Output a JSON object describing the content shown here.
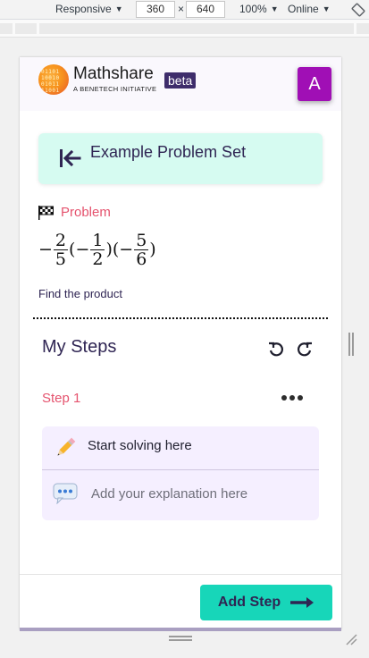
{
  "devtools": {
    "device": "Responsive",
    "width": "360",
    "times": "×",
    "height": "640",
    "zoom": "100%",
    "network": "Online"
  },
  "header": {
    "brand": "Mathshare",
    "tagline": "A BENETECH INITIATIVE",
    "badge": "beta",
    "avatar_letter": "A",
    "avatar_color": "#a00fb5"
  },
  "problem_set": {
    "title": "Example Problem Set"
  },
  "problem": {
    "label": "Problem",
    "expression": {
      "minus": "−",
      "f1_num": "2",
      "f1_den": "5",
      "open": "(",
      "f2_num": "1",
      "f2_den": "2",
      "close_open": ")(",
      "f3_num": "5",
      "f3_den": "6",
      "close": ")"
    },
    "instruction": "Find the product"
  },
  "steps": {
    "title": "My Steps",
    "step_label": "Step 1",
    "solve_placeholder": "Start solving here",
    "explain_placeholder": "Add your explanation here"
  },
  "actions": {
    "add_step": "Add Step"
  },
  "colors": {
    "accent": "#17d6b9",
    "problem_set_bg": "#d6fbf1",
    "highlight": "#e5536e",
    "text_primary": "#2f2553"
  },
  "icons": [
    "chevron-down-icon",
    "rotate-icon",
    "ruler-bar-icon",
    "logo-icon",
    "collapse-left-icon",
    "flag-icon",
    "undo-icon",
    "redo-icon",
    "more-options-icon",
    "pencil-icon",
    "speech-bubble-icon",
    "arrow-right-icon",
    "resize-handle-icon"
  ]
}
